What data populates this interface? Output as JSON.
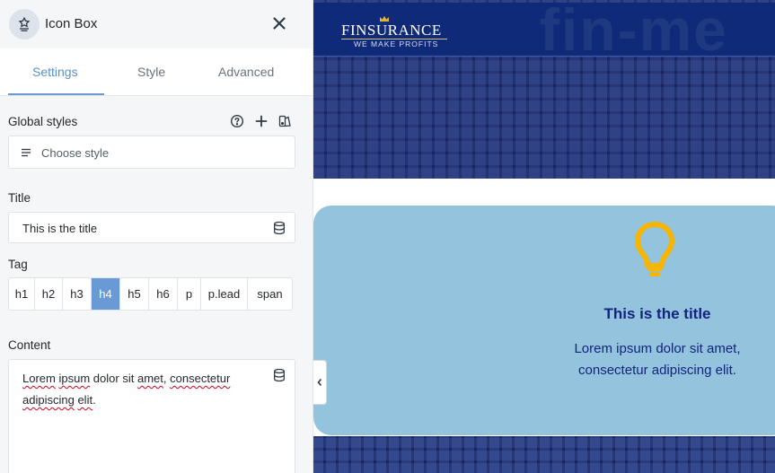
{
  "panel": {
    "title": "Icon Box",
    "tabs": [
      {
        "label": "Settings",
        "active": true
      },
      {
        "label": "Style",
        "active": false
      },
      {
        "label": "Advanced",
        "active": false
      }
    ],
    "global_styles": {
      "label": "Global styles",
      "placeholder": "Choose style",
      "tool_icons": [
        "help-icon",
        "plus-icon",
        "style-manager-icon"
      ]
    },
    "title_field": {
      "label": "Title",
      "value": "This is the title"
    },
    "tag_field": {
      "label": "Tag",
      "options": [
        "h1",
        "h2",
        "h3",
        "h4",
        "h5",
        "h6",
        "p",
        "p.lead",
        "span"
      ],
      "selected": "h4"
    },
    "content_field": {
      "label": "Content",
      "value": "Lorem ipsum dolor sit amet, consectetur adipiscing elit."
    }
  },
  "preview": {
    "logo": {
      "name": "Finsurance",
      "tagline": "WE MAKE PROFITS"
    },
    "background_word": "fin-me",
    "icon_box": {
      "icon": "lightbulb-icon",
      "title": "This is the title",
      "content": "Lorem ipsum dolor sit amet, consectetur adipiscing elit."
    }
  },
  "colors": {
    "accent": "#6a9ad6",
    "header_blue": "#0f2a78",
    "card_bg": "#94c3dd",
    "card_text": "#13237e",
    "bulb": "#f7b500"
  }
}
